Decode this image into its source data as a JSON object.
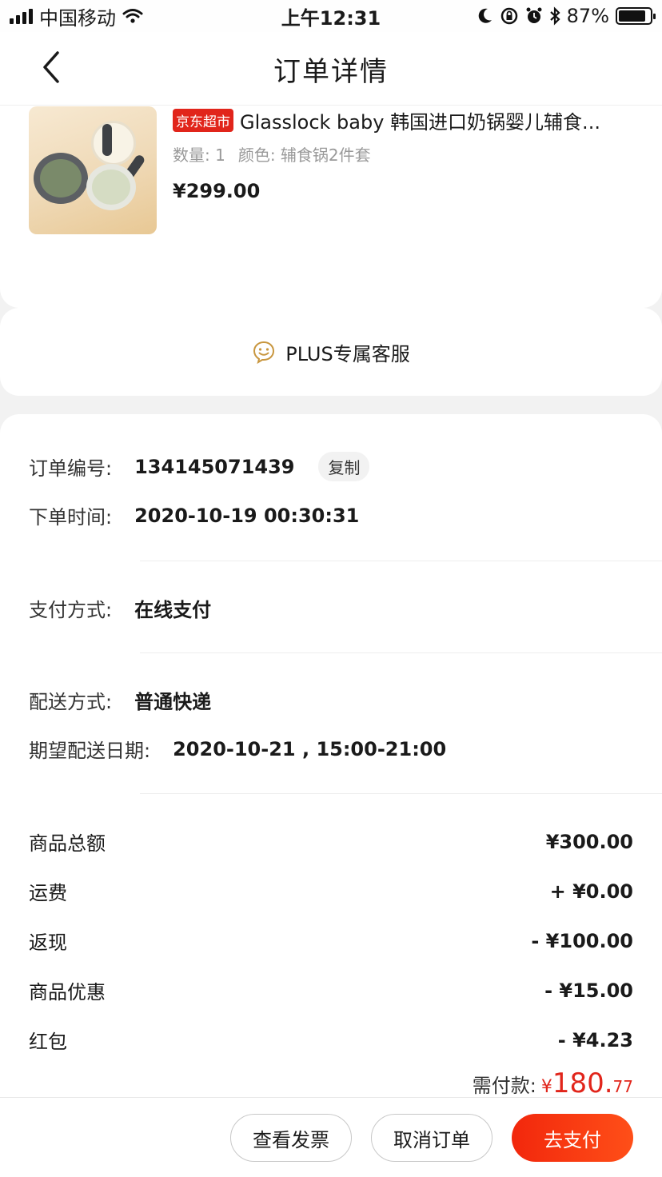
{
  "status_bar": {
    "carrier": "中国移动",
    "time": "上午12:31",
    "battery": "87%",
    "battery_level": 0.87
  },
  "nav": {
    "title": "订单详情"
  },
  "product": {
    "tag": "京东超市",
    "name": "Glasslock baby 韩国进口奶锅婴儿辅食...",
    "quantity": "数量: 1",
    "color": "颜色: 辅食锅2件套",
    "price": "¥299.00"
  },
  "service": {
    "label": "PLUS专属客服"
  },
  "order": {
    "number_label": "订单编号:",
    "number": "134145071439",
    "copy_label": "复制",
    "time_label": "下单时间:",
    "time": "2020-10-19 00:30:31",
    "payment_label": "支付方式:",
    "payment": "在线支付",
    "delivery_label": "配送方式:",
    "delivery": "普通快递",
    "expected_label": "期望配送日期:",
    "expected": "2020-10-21 , 15:00-21:00"
  },
  "amounts": {
    "items": [
      {
        "label": "商品总额",
        "value": "¥300.00"
      },
      {
        "label": "运费",
        "value": "+ ¥0.00"
      },
      {
        "label": "返现",
        "value": "- ¥100.00"
      },
      {
        "label": "商品优惠",
        "value": "- ¥15.00"
      },
      {
        "label": "红包",
        "value": "- ¥4.23"
      }
    ],
    "payable_label": "需付款:",
    "payable_currency": "¥",
    "payable_int": "180.",
    "payable_dec": "77"
  },
  "actions": {
    "invoice": "查看发票",
    "cancel": "取消订单",
    "pay": "去支付"
  },
  "colors": {
    "accent": "#e1251b",
    "plus_gold": "#c8963e"
  }
}
